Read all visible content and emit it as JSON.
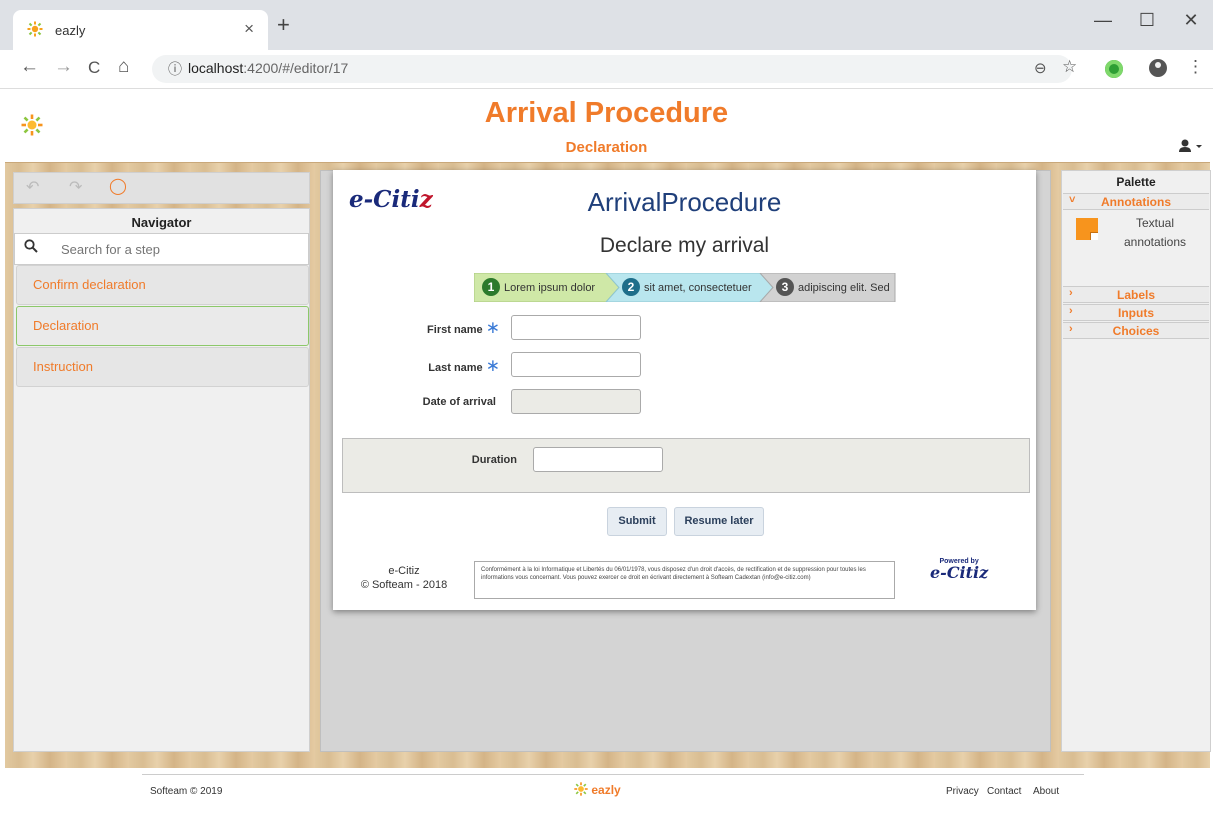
{
  "browser": {
    "tab_title": "eazly",
    "tab_close": "×",
    "new_tab": "+",
    "url_host": "localhost",
    "url_path": ":4200/#/editor/17",
    "window_min": "—",
    "window_max": "☐",
    "window_close": "✕",
    "back": "←",
    "forward": "→",
    "reload": "C",
    "home": "⌂",
    "info": "ⓘ",
    "zoom": "⊖",
    "bookmark": "☆",
    "menu": "⋮"
  },
  "header": {
    "title": "Arrival Procedure",
    "subtitle": "Declaration"
  },
  "toolbar": {
    "undo": "↶",
    "redo": "↷",
    "comment": "◯"
  },
  "navigator": {
    "title": "Navigator",
    "search_placeholder": "Search for a step",
    "steps": [
      {
        "label": "Confirm declaration"
      },
      {
        "label": "Declaration"
      },
      {
        "label": "Instruction"
      }
    ]
  },
  "form": {
    "logo_main": "e-Citi",
    "logo_z": "z",
    "title": "ArrivalProcedure",
    "subtitle": "Declare my arrival",
    "wizard": [
      {
        "num": "1",
        "label": "Lorem ipsum dolor"
      },
      {
        "num": "2",
        "label": "sit amet, consectetuer"
      },
      {
        "num": "3",
        "label": "adipiscing elit. Sed"
      }
    ],
    "fields": {
      "first_name": "First name",
      "last_name": "Last name",
      "date_of_arrival": "Date of arrival",
      "duration": "Duration",
      "required_marker": "∗"
    },
    "buttons": {
      "submit": "Submit",
      "resume": "Resume later"
    },
    "footer_name": "e-Citiz",
    "footer_copyright": "© Softeam - 2018",
    "legal_text": "Conformément à la loi Informatique et Libertés du 06/01/1978, vous disposez d'un droit d'accès, de rectification et de suppression pour toutes les informations vous concernant. Vous pouvez exercer ce droit en écrivant directement à Softeam Cadextan (info@e-citiz.com)",
    "powered_by": "Powered by",
    "powered_logo": "e-Citiz"
  },
  "palette": {
    "title": "Palette",
    "sections": [
      {
        "label": "Annotations",
        "expanded": true
      },
      {
        "label": "Labels",
        "expanded": false
      },
      {
        "label": "Inputs",
        "expanded": false
      },
      {
        "label": "Choices",
        "expanded": false
      }
    ],
    "chev_open": "˅",
    "chev_closed": "›",
    "item_label": "Textual annotations"
  },
  "footer": {
    "copyright": "Softeam © 2019",
    "logo": "eazly",
    "links": [
      "Privacy",
      "Contact",
      "About"
    ]
  },
  "colors": {
    "accent": "#f07b2a",
    "form_title": "#1f3f7a",
    "wizard_1": "#cfe8a7",
    "wizard_2": "#b9e6ee",
    "wizard_3": "#cfcfcf"
  }
}
